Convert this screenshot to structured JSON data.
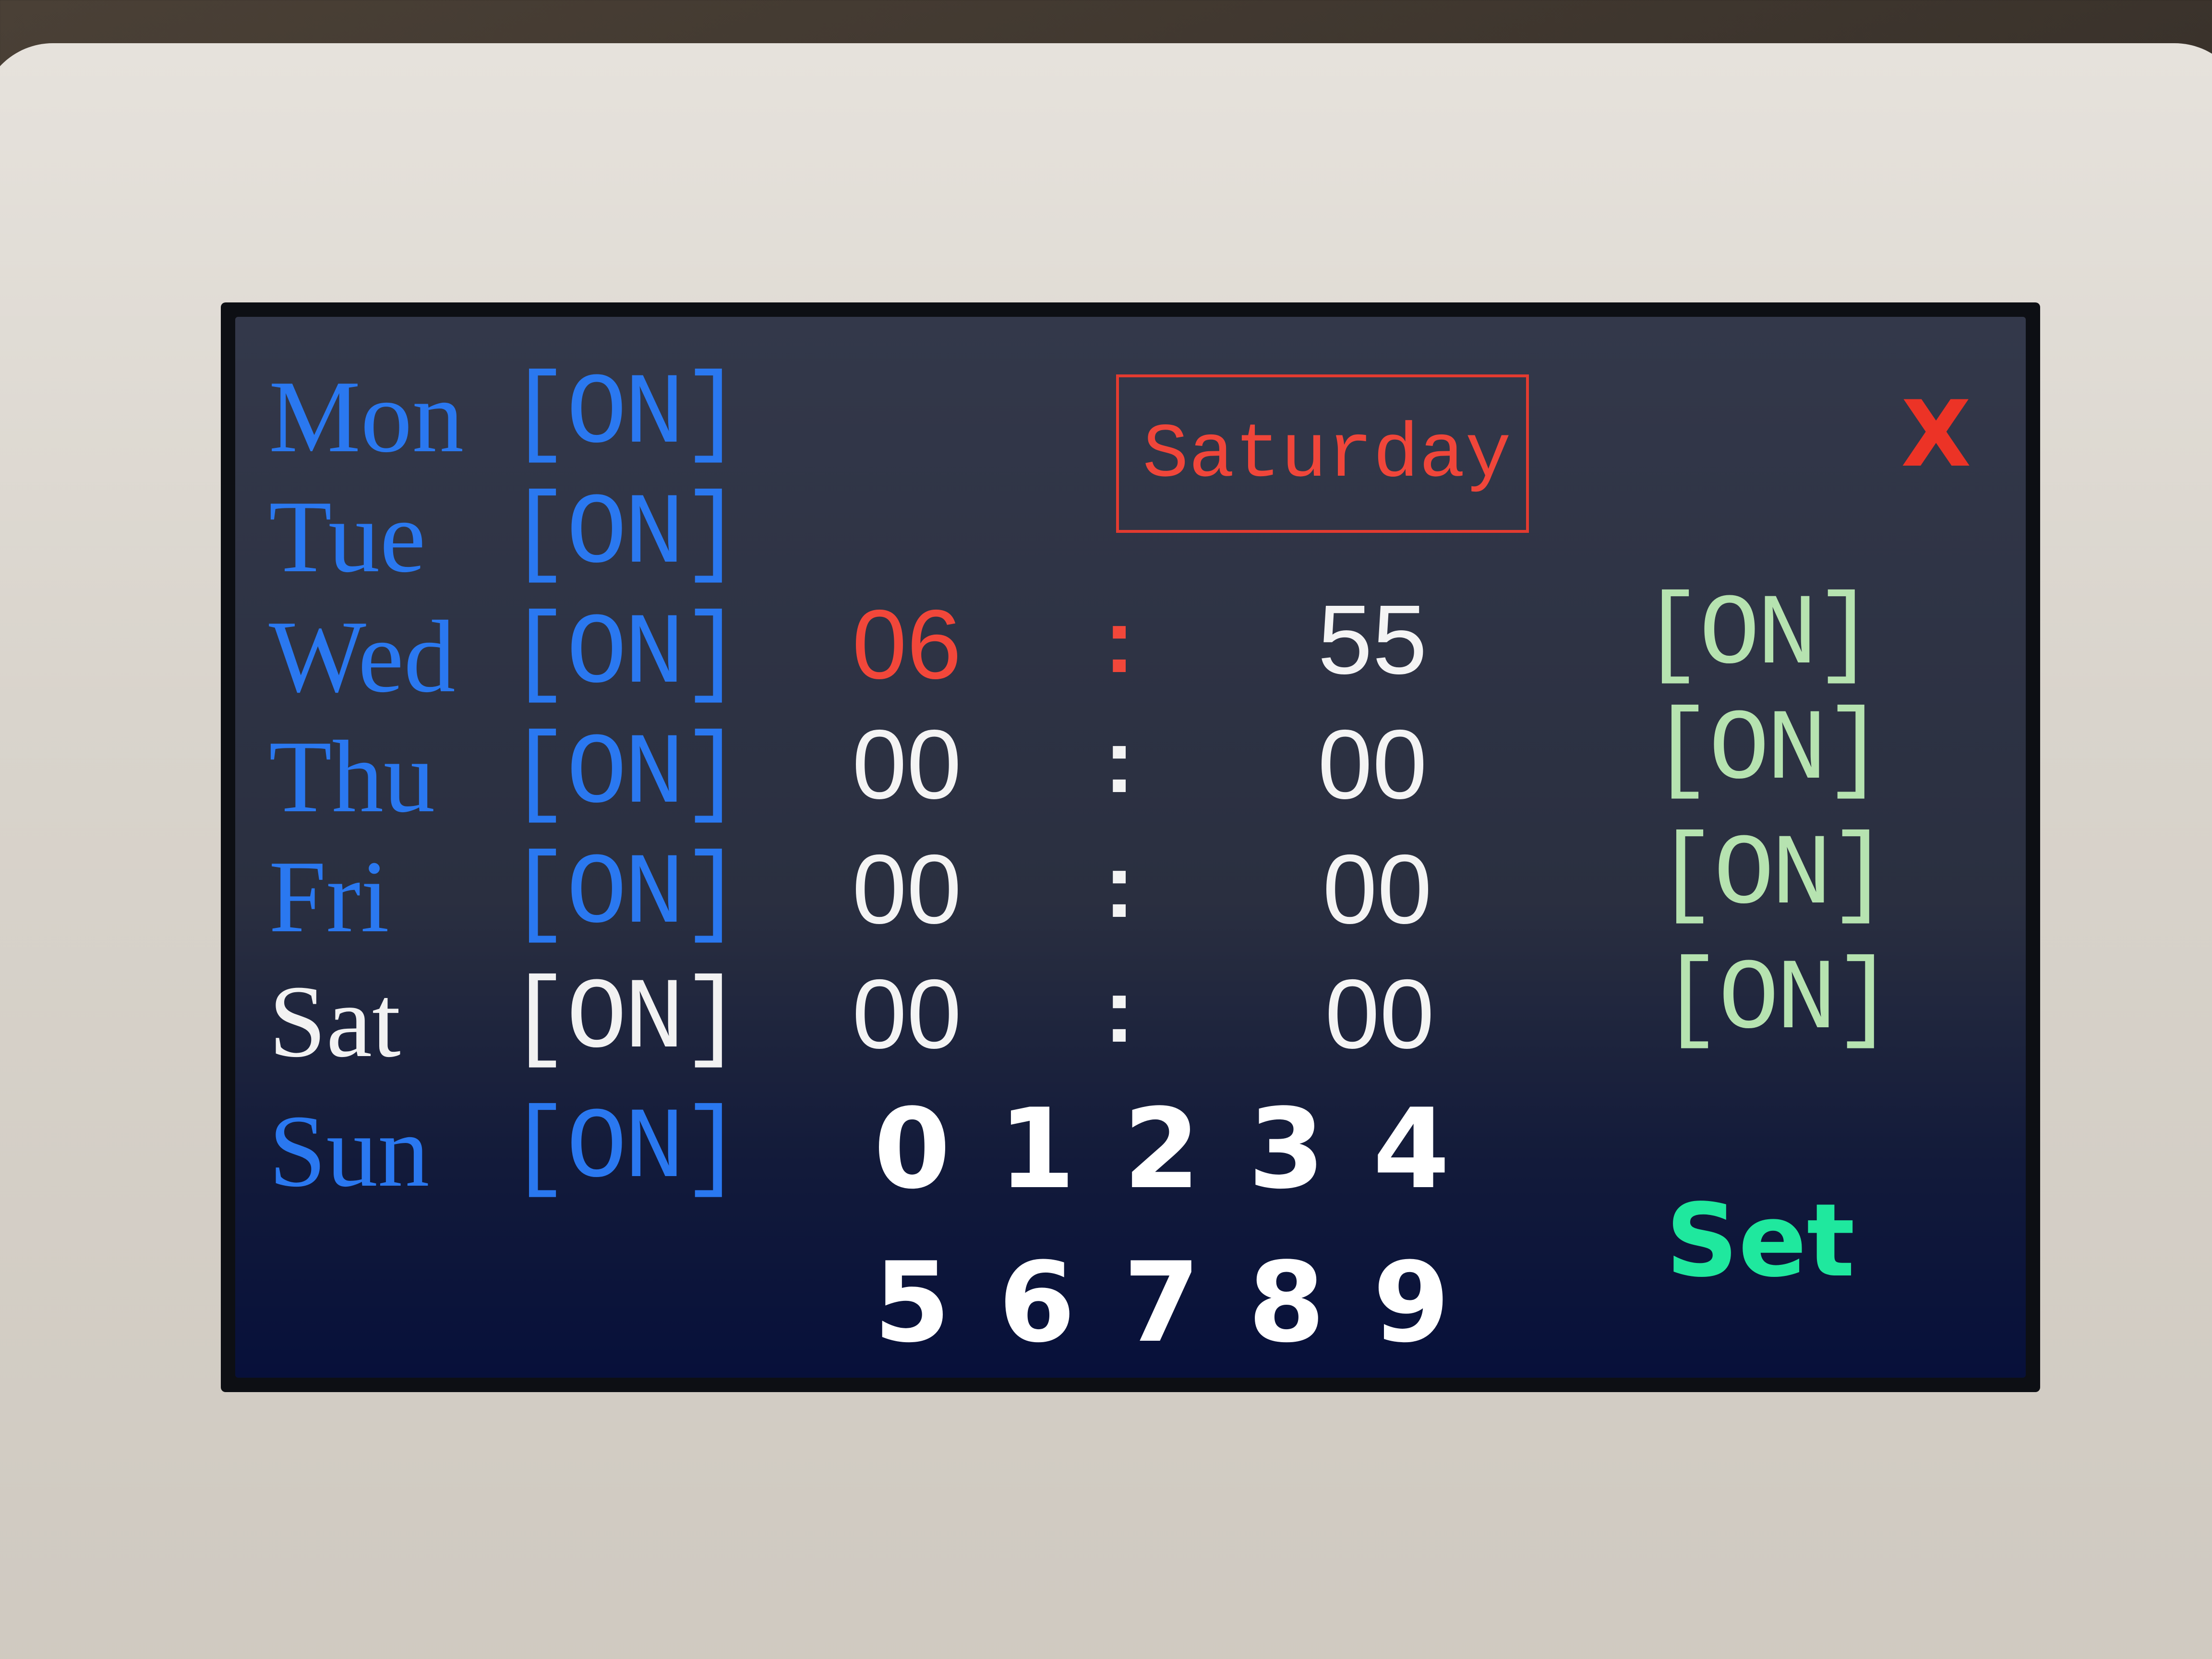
{
  "close_label": "X",
  "current_day": "Saturday",
  "days": [
    {
      "label": "Mon",
      "status": "[ON]"
    },
    {
      "label": "Tue",
      "status": "[ON]"
    },
    {
      "label": "Wed",
      "status": "[ON]"
    },
    {
      "label": "Thu",
      "status": "[ON]"
    },
    {
      "label": "Fri",
      "status": "[ON]"
    },
    {
      "label": "Sat",
      "status": "[ON]"
    },
    {
      "label": "Sun",
      "status": "[ON]"
    }
  ],
  "selected_day": "Sat",
  "alarms": [
    {
      "hour": "06",
      "separator": ":",
      "minute": "55",
      "status": "[ON]"
    },
    {
      "hour": "00",
      "separator": ":",
      "minute": "00",
      "status": "[ON]"
    },
    {
      "hour": "00",
      "separator": ":",
      "minute": "00",
      "status": "[ON]"
    },
    {
      "hour": "00",
      "separator": ":",
      "minute": "00",
      "status": "[ON]"
    }
  ],
  "keypad": [
    "0",
    "1",
    "2",
    "3",
    "4",
    "5",
    "6",
    "7",
    "8",
    "9"
  ],
  "set_label": "Set",
  "colors": {
    "day_label": "#2a78f0",
    "selected_day": "#f2f2f2",
    "selected_time": "#f2473a",
    "alarm_toggle": "#b6e3b0",
    "set_button": "#1fe89e",
    "close_button": "#ec3326"
  }
}
